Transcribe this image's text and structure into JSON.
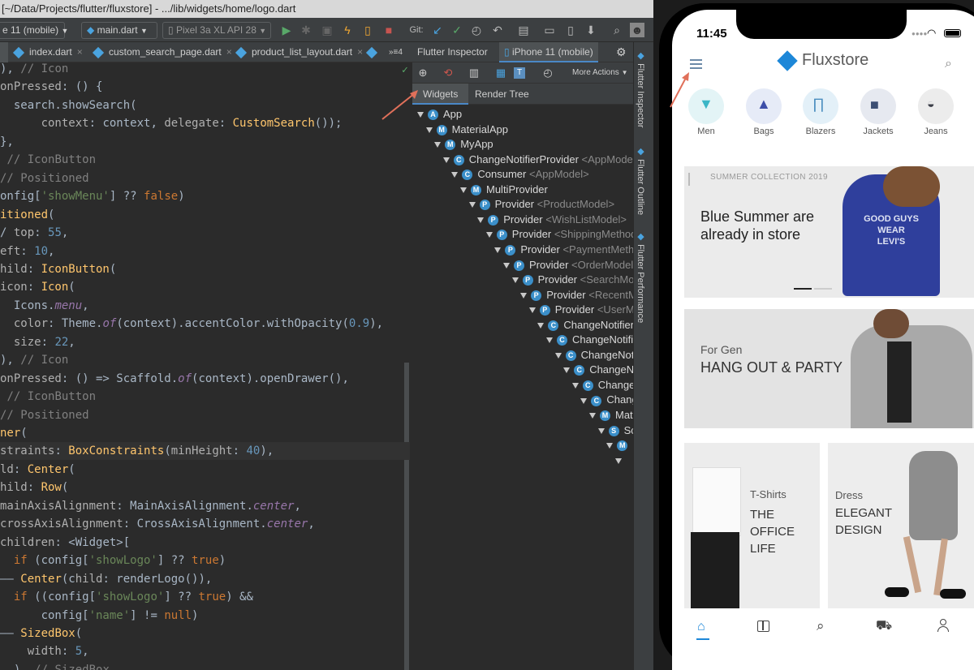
{
  "ide": {
    "title": "[~/Data/Projects/flutter/fluxstore] - .../lib/widgets/home/logo.dart",
    "toolbar": {
      "device_select": "e 11 (mobile)",
      "run_config": "main.dart",
      "emulator": "Pixel 3a XL API 28",
      "git_label": "Git:"
    },
    "tabs": [
      "index.dart",
      "custom_search_page.dart",
      "product_list_layout.dart"
    ],
    "tab_overflow": "»≡4"
  },
  "inspector": {
    "tabs": [
      "Flutter Inspector",
      "iPhone 11 (mobile)"
    ],
    "more_actions": "More Actions",
    "subtabs": [
      "Widgets",
      "Render Tree"
    ],
    "tree": [
      {
        "b": "A",
        "name": "App",
        "gen": ""
      },
      {
        "b": "M",
        "name": "MaterialApp",
        "gen": ""
      },
      {
        "b": "M",
        "name": "MyApp",
        "gen": ""
      },
      {
        "b": "C",
        "name": "ChangeNotifierProvider",
        "gen": "<AppModel>"
      },
      {
        "b": "C",
        "name": "Consumer",
        "gen": "<AppModel>"
      },
      {
        "b": "M",
        "name": "MultiProvider",
        "gen": ""
      },
      {
        "b": "P",
        "name": "Provider",
        "gen": "<ProductModel>"
      },
      {
        "b": "P",
        "name": "Provider",
        "gen": "<WishListModel>"
      },
      {
        "b": "P",
        "name": "Provider",
        "gen": "<ShippingMethod"
      },
      {
        "b": "P",
        "name": "Provider",
        "gen": "<PaymentMetho"
      },
      {
        "b": "P",
        "name": "Provider",
        "gen": "<OrderModel>"
      },
      {
        "b": "P",
        "name": "Provider",
        "gen": "<SearchMo"
      },
      {
        "b": "P",
        "name": "Provider",
        "gen": "<RecentM"
      },
      {
        "b": "P",
        "name": "Provider",
        "gen": "<UserM"
      },
      {
        "b": "C",
        "name": "ChangeNotifierl",
        "gen": ""
      },
      {
        "b": "C",
        "name": "ChangeNotifi",
        "gen": ""
      },
      {
        "b": "C",
        "name": "ChangeNot",
        "gen": ""
      },
      {
        "b": "C",
        "name": "ChangeN",
        "gen": ""
      },
      {
        "b": "C",
        "name": "Change",
        "gen": ""
      },
      {
        "b": "C",
        "name": "Chang",
        "gen": ""
      },
      {
        "b": "M",
        "name": "Mat",
        "gen": ""
      },
      {
        "b": "S",
        "name": "Sc",
        "gen": ""
      },
      {
        "b": "M",
        "name": "",
        "gen": ""
      },
      {
        "b": "",
        "name": "",
        "gen": ""
      }
    ],
    "side_tabs": [
      "Flutter Inspector",
      "Flutter Outline",
      "Flutter Performance"
    ]
  },
  "code_lines": [
    "), // Icon",
    "onPressed: () {",
    "  search.showSearch(",
    "      context: context, delegate: CustomSearch());",
    "},",
    " // IconButton",
    "// Positioned",
    "onfig['showMenu'] ?? false)",
    "itioned(",
    "/ top: 55,",
    "eft: 10,",
    "hild: IconButton(",
    "icon: Icon(",
    "  Icons.menu,",
    "  color: Theme.of(context).accentColor.withOpacity(0.9),",
    "  size: 22,",
    "), // Icon",
    "onPressed: () => Scaffold.of(context).openDrawer(),",
    " // IconButton",
    "// Positioned",
    "ner(",
    "straints: BoxConstraints(minHeight: 40),",
    "ld: Center(",
    "hild: Row(",
    "mainAxisAlignment: MainAxisAlignment.center,",
    "crossAxisAlignment: CrossAxisAlignment.center,",
    "children: <Widget>[",
    "  if (config['showLogo'] ?? true)",
    "—— Center(child: renderLogo()),",
    "  if ((config['showLogo'] ?? true) &&",
    "      config['name'] != null)",
    "—— SizedBox(",
    "    width: 5,",
    "  ), // SizedBox"
  ],
  "phone": {
    "time": "11:45",
    "brand": "Fluxstore",
    "categories": [
      "Men",
      "Bags",
      "Blazers",
      "Jackets",
      "Jeans"
    ],
    "banner1": {
      "tag": "SUMMER COLLECTION 2019",
      "title": "Blue Summer are already in store"
    },
    "banner2": {
      "subtitle": "For Gen",
      "title": "HANG OUT & PARTY"
    },
    "banner3": {
      "subtitle": "T-Shirts",
      "title": "THE OFFICE LIFE"
    },
    "banner4": {
      "subtitle": "Dress",
      "title": "ELEGANT DESIGN"
    }
  },
  "colors": {
    "accent": "#1d87d8",
    "keyword": "#cc7832",
    "string": "#6a8759",
    "number": "#6897bb",
    "arrow": "#e0705a"
  }
}
